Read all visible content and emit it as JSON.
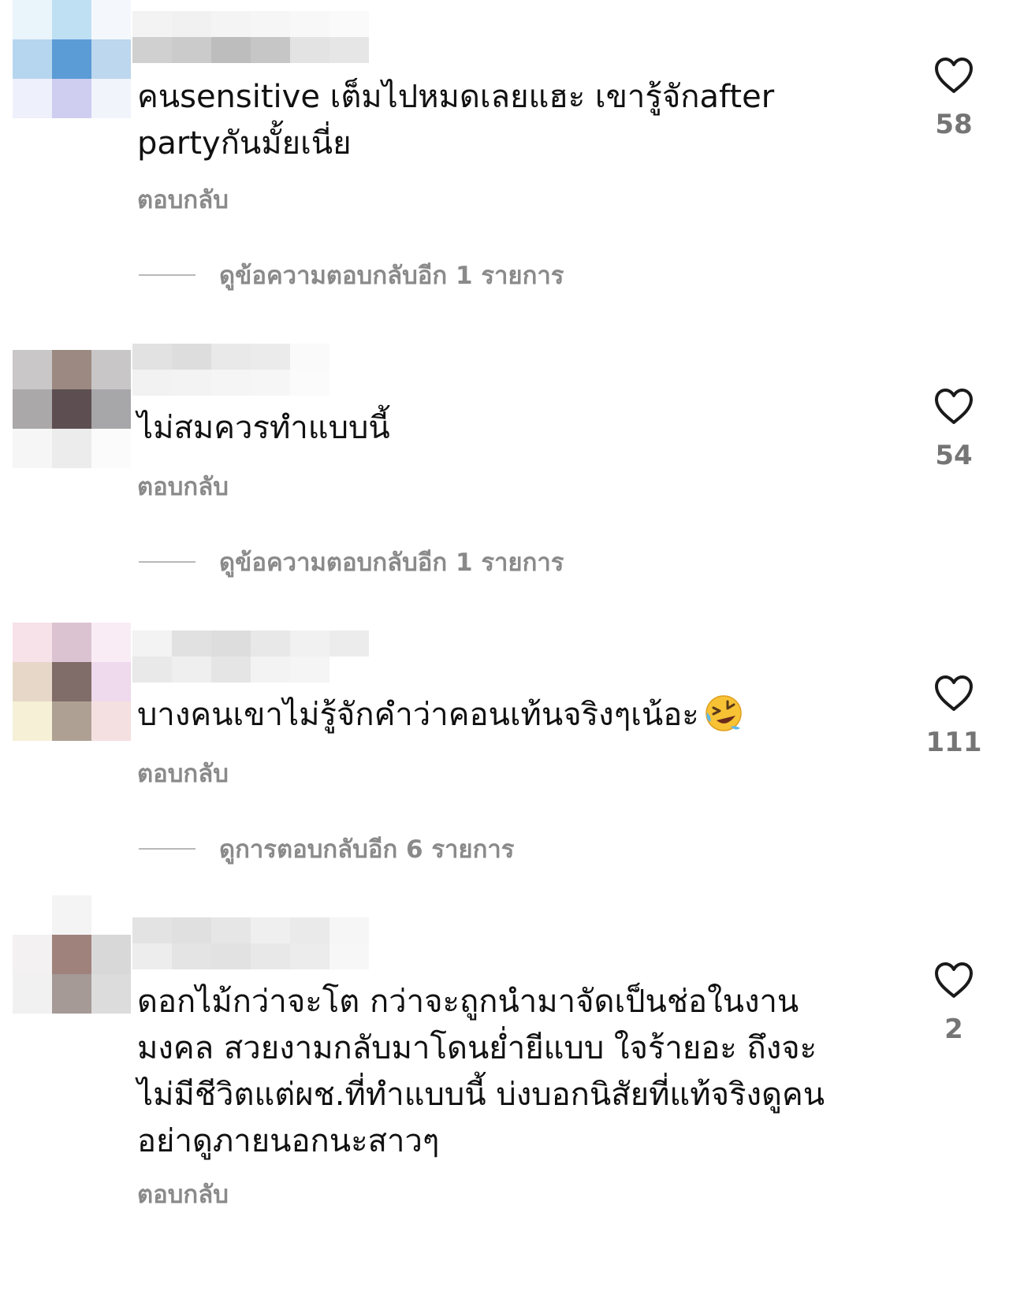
{
  "colors": {
    "text": "#111111",
    "secondary": "#8a8a8a",
    "like_count": "#757575",
    "heart_outline": "#1a1a1a"
  },
  "comments": [
    {
      "text": "คนsensitive เต็มไปหมดเลยแฮะ เขารู้จักafter partyกันมั้ยเนี่ย",
      "reply_label": "ตอบกลับ",
      "view_replies_label": "ดูข้อความตอบกลับอีก 1 รายการ",
      "like_count": "58",
      "like_icon": "heart-outline-icon"
    },
    {
      "text": "ไม่สมควรทำแบบนี้",
      "reply_label": "ตอบกลับ",
      "view_replies_label": "ดูข้อความตอบกลับอีก 1 รายการ",
      "like_count": "54",
      "like_icon": "heart-outline-icon"
    },
    {
      "text": "บางคนเขาไม่รู้จักคำว่าคอนเท้นจริงๆเน้อะ",
      "emoji": "rolling-on-the-floor-laughing-emoji",
      "reply_label": "ตอบกลับ",
      "view_replies_label": "ดูการตอบกลับอีก 6 รายการ",
      "like_count": "111",
      "like_icon": "heart-outline-icon"
    },
    {
      "text": "ดอกไม้กว่าจะโต กว่าจะถูกนำมาจัดเป็นช่อในงานมงคล สวยงามกลับมาโดนย่ำยีแบบ ใจร้ายอะ ถึงจะไม่มีชีวิตแต่ผช.ที่ทำแบบนี้ บ่งบอกนิสัยที่แท้จริงดูคนอย่าดูภายนอกนะสาวๆ",
      "reply_label": "ตอบกลับ",
      "like_count": "2",
      "like_icon": "heart-outline-icon"
    }
  ]
}
